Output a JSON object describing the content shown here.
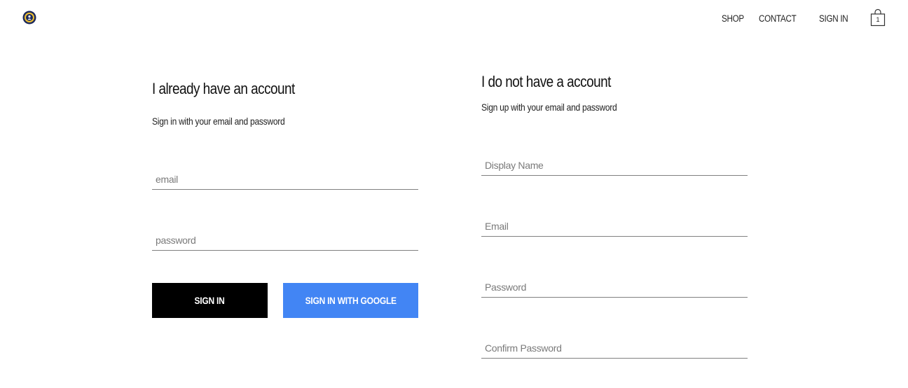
{
  "header": {
    "logo_icon": "crown-logo-icon",
    "nav": {
      "shop": "SHOP",
      "contact": "CONTACT",
      "sign_in": "SIGN IN"
    },
    "cart": {
      "icon": "shopping-bag-icon",
      "count": "1"
    }
  },
  "sign_in": {
    "title": "I already have an account",
    "subtitle": "Sign in with your email and password",
    "email_placeholder": "email",
    "password_placeholder": "password",
    "sign_in_button": "SIGN IN",
    "google_button": "SIGN IN WITH GOOGLE",
    "google_button_color": "#4285f4"
  },
  "sign_up": {
    "title": "I do not have a account",
    "subtitle": "Sign up with your email and password",
    "display_name_placeholder": "Display Name",
    "email_placeholder": "Email",
    "password_placeholder": "Password",
    "confirm_password_placeholder": "Confirm Password"
  }
}
